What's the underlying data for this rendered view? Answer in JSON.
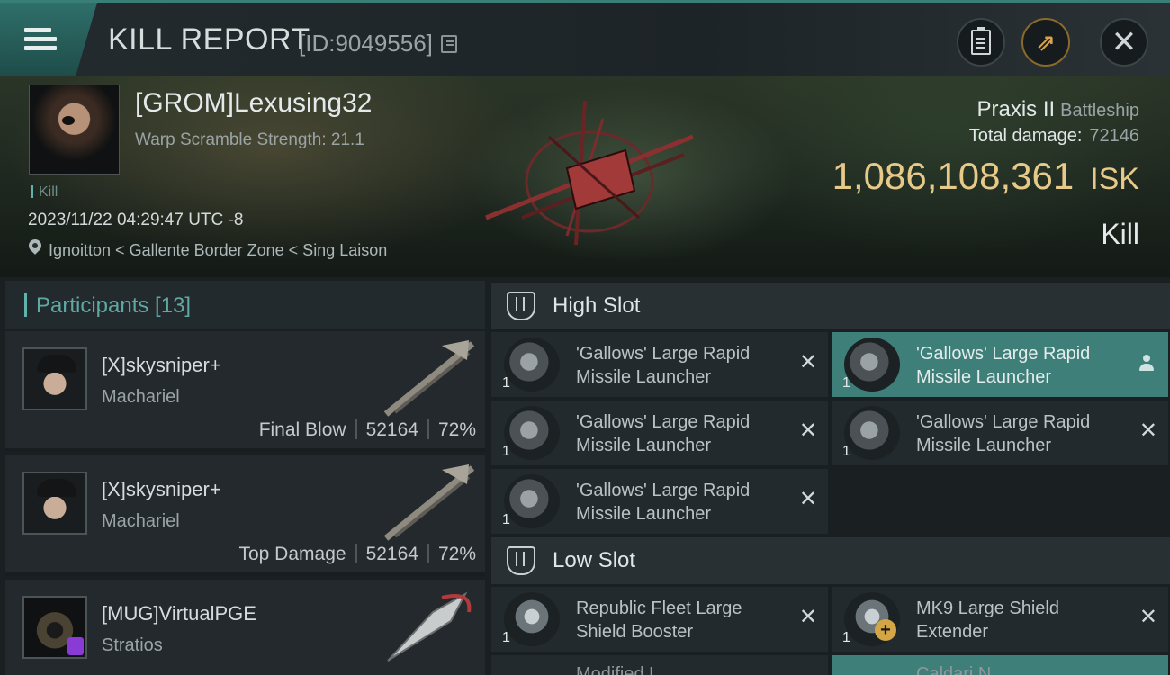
{
  "header": {
    "title": "KILL REPORT",
    "report_id": "[ID:9049556]",
    "icons": [
      "menu-icon",
      "copy-icon",
      "clipboard-icon",
      "share-icon",
      "close-icon"
    ]
  },
  "victim": {
    "name": "[GROM]Lexusing32",
    "warp_scramble": "Warp Scramble Strength: 21.1",
    "kill_tag": "Kill",
    "datetime": "2023/11/22 04:29:47 UTC -8",
    "location": "Ignoitton < Gallente Border Zone < Sing Laison",
    "ship_name": "Praxis II",
    "ship_class": "Battleship",
    "total_damage_label": "Total damage:",
    "total_damage_value": "72146",
    "isk_value": "1,086,108,361",
    "isk_unit": "ISK",
    "result": "Kill"
  },
  "participants": {
    "label": "Participants [13]",
    "items": [
      {
        "name": "[X]skysniper+",
        "ship": "Machariel",
        "role": "Final Blow",
        "damage": "52164",
        "percent": "72%"
      },
      {
        "name": "[X]skysniper+",
        "ship": "Machariel",
        "role": "Top Damage",
        "damage": "52164",
        "percent": "72%"
      },
      {
        "name": "[MUG]VirtualPGE",
        "ship": "Stratios",
        "role": "",
        "damage": "",
        "percent": ""
      }
    ]
  },
  "slots": {
    "high": {
      "label": "High Slot",
      "modules": [
        {
          "name": "'Gallows' Large Rapid Missile Launcher",
          "qty": "1"
        },
        {
          "name": "'Gallows' Large Rapid Missile Launcher",
          "qty": "1"
        },
        {
          "name": "'Gallows' Large Rapid Missile Launcher",
          "qty": "1"
        },
        {
          "name": "'Gallows' Large Rapid Missile Launcher",
          "qty": "1"
        },
        {
          "name": "'Gallows' Large Rapid Missile Launcher",
          "qty": "1"
        }
      ]
    },
    "low": {
      "label": "Low Slot",
      "modules": [
        {
          "name": "Republic Fleet Large Shield Booster",
          "qty": "1"
        },
        {
          "name": "MK9 Large Shield Extender",
          "qty": "1"
        }
      ],
      "peek": [
        "Modified L...",
        "Caldari N..."
      ]
    }
  },
  "colors": {
    "accent_teal": "#5fb3ac",
    "isk_gold": "#e7c98a",
    "highlight_row": "#3f7f79"
  }
}
